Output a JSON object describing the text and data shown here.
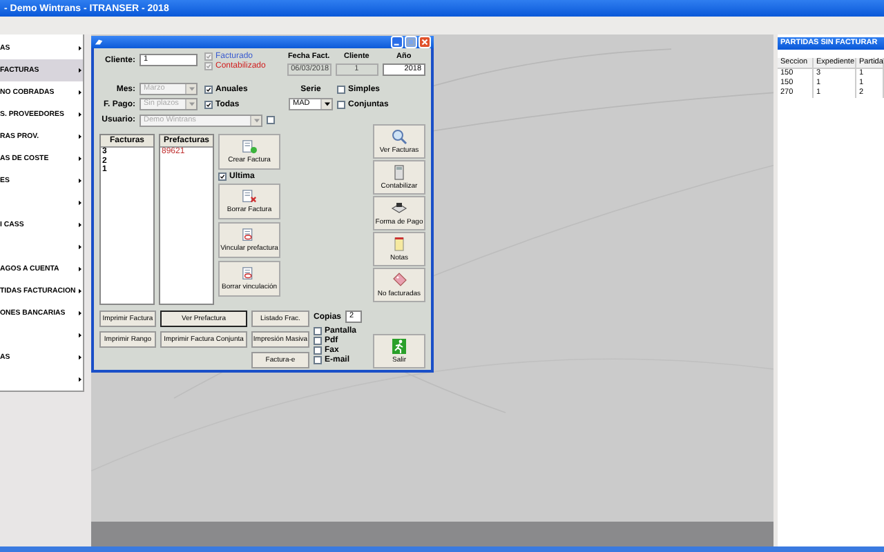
{
  "window": {
    "title": "- Demo Wintrans - ITRANSER - 2018"
  },
  "menu": {
    "items": [
      {
        "label": "AS",
        "selected": false
      },
      {
        "label": "FACTURAS",
        "selected": true
      },
      {
        "label": "NO COBRADAS",
        "selected": false
      },
      {
        "label": "S. PROVEEDORES",
        "selected": false
      },
      {
        "label": "RAS PROV.",
        "selected": false
      },
      {
        "label": "AS DE COSTE",
        "selected": false
      },
      {
        "label": "ES",
        "selected": false
      },
      {
        "selected": false
      },
      {
        "label": "I CASS",
        "selected": false
      },
      {
        "selected": false
      },
      {
        "label": "AGOS A CUENTA",
        "selected": false
      },
      {
        "label": "TIDAS FACTURACION",
        "selected": false
      },
      {
        "label": "ONES BANCARIAS",
        "selected": false
      },
      {
        "selected": false
      },
      {
        "label": "AS",
        "selected": false
      },
      {
        "selected": false
      }
    ]
  },
  "dialog": {
    "cliente": {
      "label": "Cliente:",
      "value": "1"
    },
    "status_checks": [
      {
        "label": "Facturado",
        "checked": true,
        "disabled": true,
        "color": "#3a5bd0"
      },
      {
        "label": "Contabilizado",
        "checked": true,
        "disabled": true,
        "color": "#d02020"
      }
    ],
    "info_fields": [
      {
        "label": "Fecha Fact.",
        "value": "06/03/2018",
        "editable": false
      },
      {
        "label": "Cliente",
        "value": "1",
        "editable": false
      },
      {
        "label": "Año",
        "value": "2018",
        "editable": true
      }
    ],
    "selects": [
      {
        "label": "Mes:",
        "value": "Marzo",
        "disabled": true
      },
      {
        "label": "F. Pago:",
        "value": "Sin plazos",
        "disabled": true
      }
    ],
    "period_checks": [
      {
        "label": "Anuales",
        "checked": true
      },
      {
        "label": "Todas",
        "checked": true
      }
    ],
    "serie": {
      "label": "Serie",
      "value": "MAD"
    },
    "type_checks": [
      {
        "label": "Simples",
        "checked": false
      },
      {
        "label": "Conjuntas",
        "checked": false
      }
    ],
    "usuario": {
      "label": "Usuario:",
      "value": "Demo Wintrans",
      "disabled": true,
      "checked": false
    },
    "facturas": {
      "heading": "Facturas",
      "items": [
        "3",
        "2",
        "1"
      ]
    },
    "prefacturas": {
      "heading": "Prefacturas",
      "items": [
        "89621"
      ]
    },
    "actions": [
      {
        "kind": "button",
        "label": "Crear Factura"
      },
      {
        "kind": "checkbox",
        "label": "Ultima",
        "checked": true
      },
      {
        "kind": "button",
        "label": "Borrar Factura"
      },
      {
        "kind": "button",
        "label": "Vincular prefactura"
      },
      {
        "kind": "button",
        "label": "Borrar vinculación"
      }
    ],
    "side_buttons": [
      {
        "label": "Ver Facturas"
      },
      {
        "label": "Contabilizar"
      },
      {
        "label": "Forma de Pago"
      },
      {
        "label": "Notas"
      },
      {
        "label": "No facturadas"
      }
    ],
    "print_columns": [
      [
        {
          "label": "Imprimir Factura",
          "focused": false
        },
        {
          "label": "Imprimir Rango",
          "focused": false
        }
      ],
      [
        {
          "label": "Ver Prefactura",
          "focused": true
        },
        {
          "label": "Imprimir Factura Conjunta",
          "focused": false
        }
      ],
      [
        {
          "label": "Listado Frac.",
          "focused": false
        },
        {
          "label": "Impresión Masiva",
          "focused": false
        },
        {
          "label": "Factura-e",
          "focused": false
        }
      ]
    ],
    "copias": {
      "label": "Copias",
      "value": "2"
    },
    "outputs": [
      {
        "label": "Pantalla",
        "checked": false
      },
      {
        "label": "Pdf",
        "checked": false
      },
      {
        "label": "Fax",
        "checked": false
      },
      {
        "label": "E-mail",
        "checked": false
      }
    ],
    "exit": {
      "label": "Salir"
    }
  },
  "right_panel": {
    "title": "PARTIDAS SIN FACTURAR",
    "columns": [
      "Seccion",
      "Expediente",
      "Partida"
    ],
    "rows": [
      [
        "150",
        "3",
        "1"
      ],
      [
        "150",
        "1",
        "1"
      ],
      [
        "270",
        "1",
        "2"
      ]
    ]
  }
}
